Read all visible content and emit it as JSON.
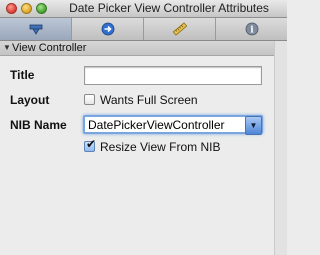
{
  "window": {
    "title": "Date Picker View Controller Attributes"
  },
  "toolbar": {
    "tabs": [
      {
        "icon": "attributes-icon",
        "selected": true
      },
      {
        "icon": "connections-icon",
        "selected": false
      },
      {
        "icon": "size-ruler-icon",
        "selected": false
      },
      {
        "icon": "info-icon",
        "selected": false
      }
    ],
    "info_glyph": "i"
  },
  "section": {
    "title": "View Controller",
    "disclosure": "▼"
  },
  "fields": {
    "title_label": "Title",
    "title_value": "",
    "layout_label": "Layout",
    "wants_full_screen_label": "Wants Full Screen",
    "wants_full_screen_checked": false,
    "nib_label": "NIB Name",
    "nib_value": "DatePickerViewController",
    "resize_label": "Resize View From NIB",
    "resize_checked": true
  },
  "colors": {
    "focus_ring": "#7aa6e0",
    "selected_tab": "#9aa7bb"
  }
}
